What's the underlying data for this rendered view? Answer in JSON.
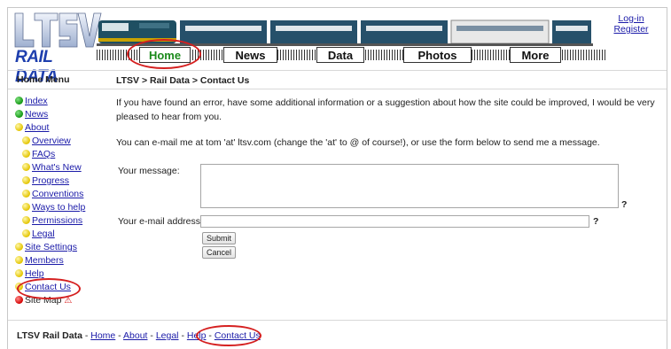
{
  "site": {
    "logo_letters": "LTSV",
    "logo_text": "RAIL DATA"
  },
  "nav": {
    "home": "Home",
    "news": "News",
    "data": "Data",
    "photos": "Photos",
    "more": "More"
  },
  "account": {
    "login": "Log-in",
    "register": "Register"
  },
  "menu": {
    "title": "Home Menu",
    "items": {
      "index": "Index",
      "news": "News",
      "about": "About",
      "overview": "Overview",
      "faqs": "FAQs",
      "whats_new": "What's New",
      "progress": "Progress",
      "conventions": "Conventions",
      "ways_to_help": "Ways to help",
      "permissions": "Permissions",
      "legal": "Legal",
      "site_settings": "Site Settings",
      "members": "Members",
      "help": "Help",
      "contact_us": "Contact Us",
      "site_map": "Site Map"
    }
  },
  "breadcrumb": "LTSV > Rail Data > Contact Us",
  "content": {
    "intro": "If you have found an error, have some additional information or a suggestion about how the site could be improved, I would be very pleased to hear from you.",
    "email_info": "You can e-mail me at tom 'at' ltsv.com (change the 'at' to @ of course!), or use the form below to send me a message."
  },
  "form": {
    "message_label": "Your message:",
    "email_label": "Your e-mail address:",
    "help_mark": "?",
    "submit": "Submit",
    "cancel": "Cancel"
  },
  "footer": {
    "site_name": "LTSV Rail Data",
    "separator": " - ",
    "links": {
      "home": "Home",
      "about": "About",
      "legal": "Legal",
      "help": "Help",
      "contact": "Contact Us"
    }
  },
  "colors": {
    "link": "#1a1aa8",
    "logo_blue": "#1e3fae",
    "annotation": "#d51f1f",
    "home_green": "#1b8a1b"
  }
}
